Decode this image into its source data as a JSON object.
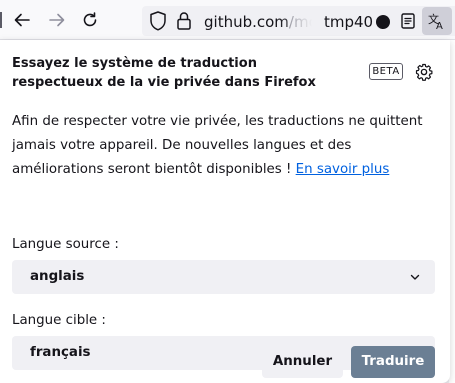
{
  "toolbar": {
    "url_domain": "github.com",
    "url_path": "/moz",
    "tab_label": "tmp40"
  },
  "panel": {
    "title": "Essayez le système de traduction respectueux de la vie privée dans Firefox",
    "beta_badge": "BETA",
    "description": "Afin de respecter votre vie privée, les traductions ne quittent jamais votre appareil. De nouvelles langues et des améliorations seront bientôt disponibles ! ",
    "learn_more": "En savoir plus",
    "source_label": "Langue source :",
    "source_value": "anglais",
    "target_label": "Langue cible :",
    "target_value": "français",
    "cancel_label": "Annuler",
    "translate_label": "Traduire"
  },
  "icons": {
    "back": "arrow-left-icon",
    "forward": "arrow-right-icon",
    "reload": "reload-icon",
    "tracking": "shield-icon",
    "security": "lock-icon",
    "recording": "record-dot-icon",
    "reader": "reader-view-icon",
    "translate": "translate-icon",
    "settings": "gear-icon",
    "dropdown": "chevron-down-icon"
  },
  "colors": {
    "accent_link": "#0061e0",
    "translate_button_bg": "#6b7f94",
    "neutral_button_bg": "#f0f0f4",
    "text": "#15141a"
  }
}
